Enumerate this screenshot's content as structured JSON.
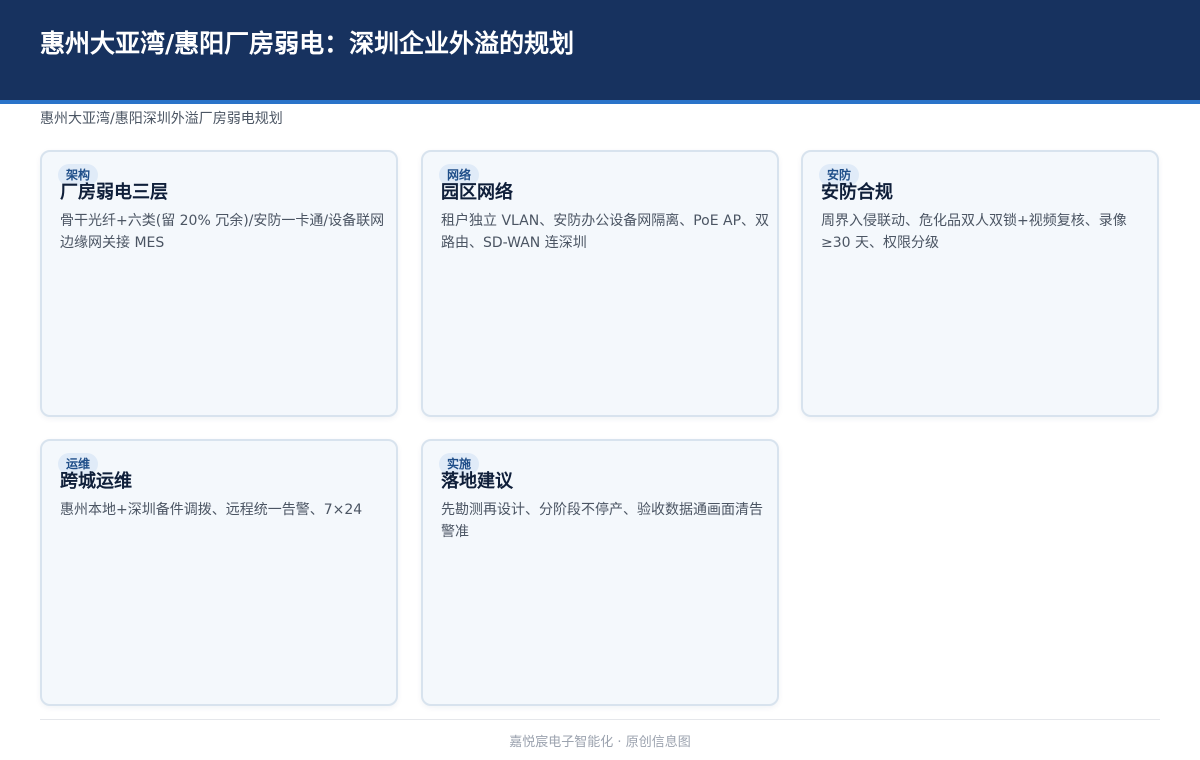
{
  "header": {
    "title": "惠州大亚湾/惠阳厂房弱电：深圳企业外溢的规划",
    "subtitle": "惠州大亚湾/惠阳深圳外溢厂房弱电规划",
    "background_color": "#17325f",
    "accent_color": "#2a73c9"
  },
  "cards": [
    {
      "tag": "架构",
      "title": "厂房弱电三层",
      "body": "骨干光纤+六类(留 20% 冗余)/安防一卡通/设备联网边缘网关接 MES"
    },
    {
      "tag": "网络",
      "title": "园区网络",
      "body": "租户独立 VLAN、安防办公设备网隔离、PoE AP、双路由、SD-WAN 连深圳"
    },
    {
      "tag": "安防",
      "title": "安防合规",
      "body": "周界入侵联动、危化品双人双锁+视频复核、录像≥30 天、权限分级"
    },
    {
      "tag": "运维",
      "title": "跨城运维",
      "body": "惠州本地+深圳备件调拨、远程统一告警、7×24"
    },
    {
      "tag": "实施",
      "title": "落地建议",
      "body": "先勘测再设计、分阶段不停产、验收数据通画面清告警准"
    }
  ],
  "footer": {
    "text": "嘉悦宸电子智能化 · 原创信息图"
  }
}
